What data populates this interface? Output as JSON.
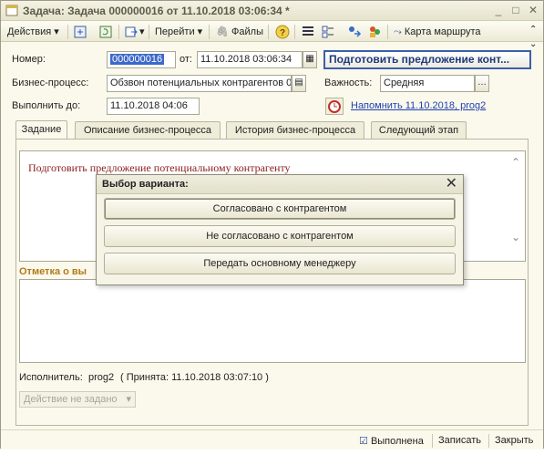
{
  "window": {
    "title": "Задача: Задача 000000016 от 11.10.2018 03:06:34 *"
  },
  "toolbar": {
    "actions_label": "Действия",
    "goto_label": "Перейти",
    "files_label": "Файлы",
    "route_map_label": "Карта маршрута"
  },
  "form": {
    "number_label": "Номер:",
    "number_value": "000000016",
    "from_label": "от:",
    "date_value": "11.10.2018 03:06:34",
    "main_button_label": "Подготовить предложение конт...",
    "process_label": "Бизнес-процесс:",
    "process_value": "Обзвон потенциальных контрагентов 0",
    "importance_label": "Важность:",
    "importance_value": "Средняя",
    "due_label": "Выполнить до:",
    "due_value": "11.10.2018  04:06",
    "reminder_link": "Напомнить 11.10.2018, prog2"
  },
  "tabs": [
    {
      "label": "Задание",
      "active": true
    },
    {
      "label": "Описание бизнес-процесса",
      "active": false
    },
    {
      "label": "История бизнес-процесса",
      "active": false
    },
    {
      "label": "Следующий этап",
      "active": false
    }
  ],
  "task": {
    "description": "Подготовить предложение потенциальному контрагенту",
    "completion_label": "Отметка о вы",
    "executor_label": "Исполнитель:",
    "executor_value": "prog2",
    "accepted_text": "( Принята: 11.10.2018 03:07:10 )",
    "action_placeholder": "Действие не задано"
  },
  "dialog": {
    "title": "Выбор варианта:",
    "options": [
      "Согласовано с контрагентом",
      "Не согласовано с контрагентом",
      "Передать основному менеджеру"
    ]
  },
  "bottom": {
    "done_label": "Выполнена",
    "save_label": "Записать",
    "close_label": "Закрыть"
  },
  "colors": {
    "accent": "#3c5fa8",
    "link": "#1f3fb0",
    "description_text": "#8a1c1c",
    "section_label": "#b07a18"
  }
}
